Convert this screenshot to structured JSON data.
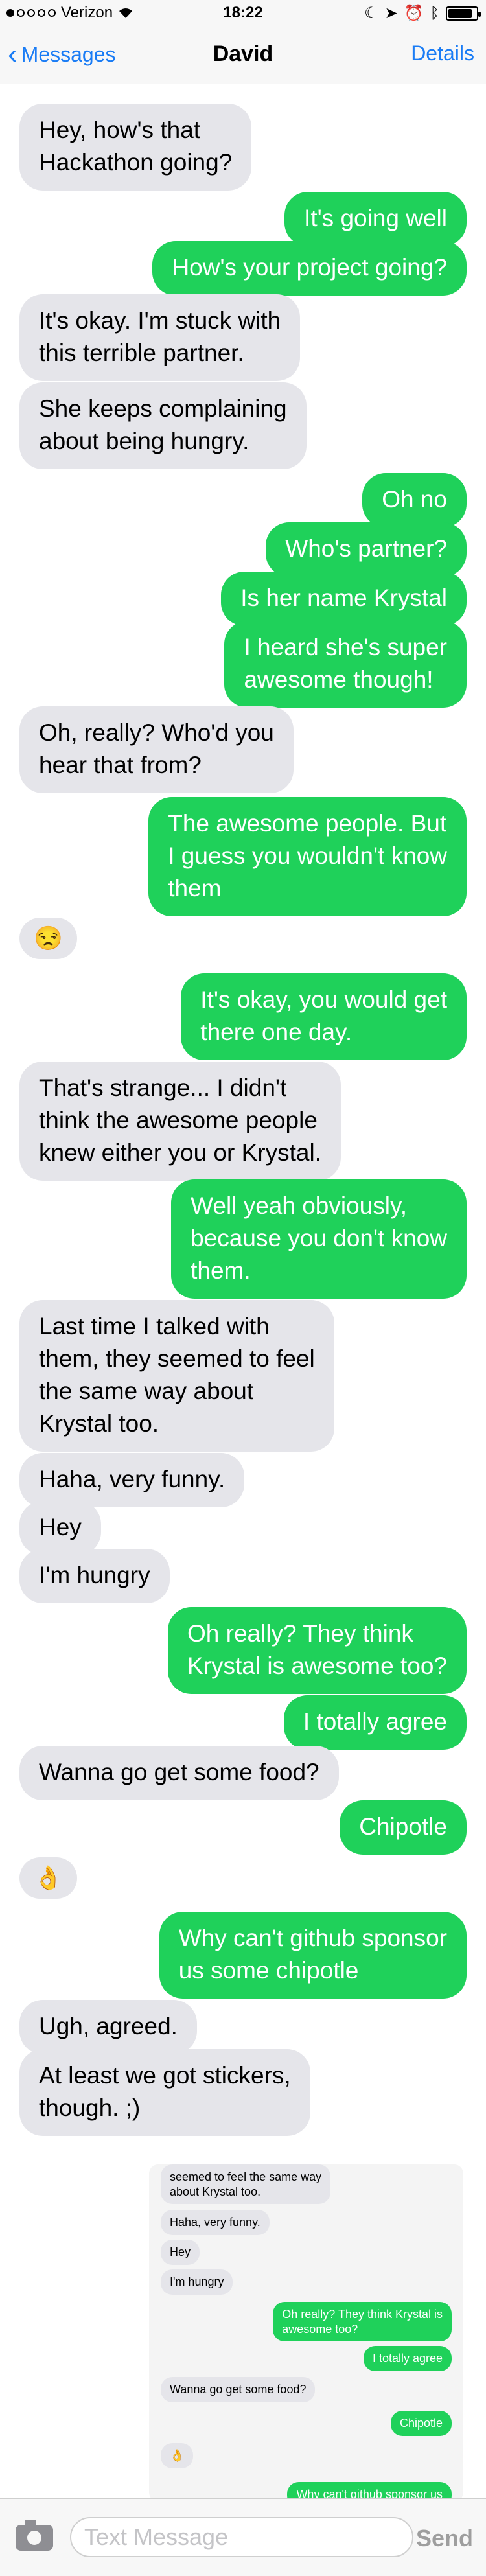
{
  "status_bar": {
    "carrier": "Verizon",
    "time": "18:22",
    "wifi_icon": "wifi-icon",
    "icons": [
      "do-not-disturb-icon",
      "location-icon",
      "alarm-icon",
      "bluetooth-icon"
    ],
    "battery_level": 0.85
  },
  "nav": {
    "back_label": "Messages",
    "title": "David",
    "details_label": "Details"
  },
  "messages": [
    {
      "dir": "in",
      "text": "Hey, how's that\nHackathon going?"
    },
    {
      "dir": "out",
      "text": "It's going well"
    },
    {
      "dir": "out",
      "text": "How's your project going?"
    },
    {
      "dir": "in",
      "text": "It's okay. I'm stuck with\nthis terrible partner."
    },
    {
      "dir": "in",
      "text": "She keeps complaining\nabout being hungry."
    },
    {
      "dir": "out",
      "text": "Oh no"
    },
    {
      "dir": "out",
      "text": "Who's partner?"
    },
    {
      "dir": "out",
      "text": "Is her name Krystal"
    },
    {
      "dir": "out",
      "text": "I heard she's super\nawesome though!"
    },
    {
      "dir": "in",
      "text": "Oh, really? Who'd you\nhear that from?"
    },
    {
      "dir": "out",
      "text": "The awesome people. But\nI guess you wouldn't know\nthem"
    },
    {
      "dir": "in",
      "text": "😒"
    },
    {
      "dir": "out",
      "text": "It's okay, you would get\nthere one day."
    },
    {
      "dir": "in",
      "text": "That's strange... I didn't\nthink the awesome people\nknew either you or Krystal."
    },
    {
      "dir": "out",
      "text": "Well yeah obviously,\nbecause you don't know\nthem."
    },
    {
      "dir": "in",
      "text": "Last time I talked with\nthem, they seemed to feel\nthe same way about\nKrystal too."
    },
    {
      "dir": "in",
      "text": "Haha, very funny."
    },
    {
      "dir": "in",
      "text": "Hey"
    },
    {
      "dir": "in",
      "text": "I'm hungry"
    },
    {
      "dir": "out",
      "text": "Oh really? They think\nKrystal is awesome too?"
    },
    {
      "dir": "out",
      "text": "I totally agree"
    },
    {
      "dir": "in",
      "text": "Wanna go get some food?"
    },
    {
      "dir": "out",
      "text": "Chipotle"
    },
    {
      "dir": "in",
      "text": "👌"
    },
    {
      "dir": "out",
      "text": "Why can't github sponsor\nus some chipotle"
    },
    {
      "dir": "in",
      "text": "Ugh, agreed."
    },
    {
      "dir": "in",
      "text": "At least we got stickers,\nthough. ;)"
    }
  ],
  "attachment": {
    "messages": [
      {
        "dir": "in",
        "text": "seemed to feel the same way\nabout Krystal too."
      },
      {
        "dir": "in",
        "text": "Haha, very funny."
      },
      {
        "dir": "in",
        "text": "Hey"
      },
      {
        "dir": "in",
        "text": "I'm hungry"
      },
      {
        "dir": "out",
        "text": "Oh really? They think Krystal is\nawesome too?"
      },
      {
        "dir": "out",
        "text": "I totally agree"
      },
      {
        "dir": "in",
        "text": "Wanna go get some food?"
      },
      {
        "dir": "out",
        "text": "Chipotle"
      },
      {
        "dir": "in",
        "text": "👌"
      },
      {
        "dir": "out",
        "text": "Why can't github sponsor us"
      }
    ]
  },
  "input": {
    "placeholder": "Text Message",
    "send_label": "Send",
    "camera_icon": "camera-icon"
  },
  "colors": {
    "incoming_bubble": "#e5e5ea",
    "outgoing_bubble": "#1fd15a",
    "link_blue": "#1a7cf5"
  }
}
